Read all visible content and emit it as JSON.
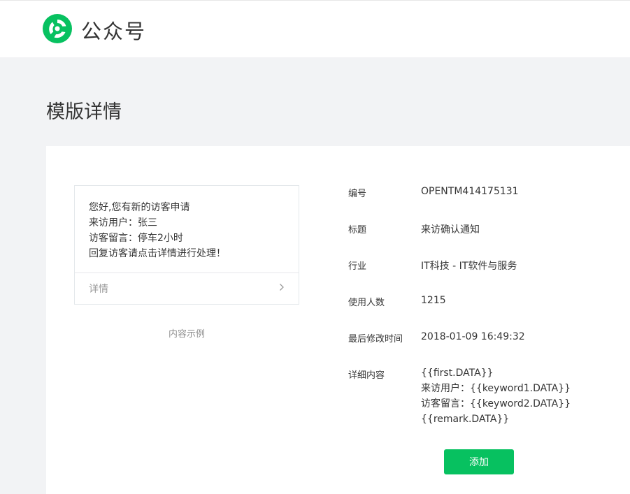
{
  "header": {
    "brand": "公众号",
    "brand_color": "#07c160",
    "logo_icon": "wechat-official-account-logo-icon"
  },
  "page": {
    "title": "模版详情"
  },
  "preview": {
    "lines": [
      "您好,您有新的访客申请",
      "来访用户：张三",
      "访客留言：停车2小时",
      "回复访客请点击详情进行处理！"
    ],
    "footer_label": "详情",
    "footer_icon": "chevron-right-icon",
    "caption": "内容示例"
  },
  "info": {
    "id_label": "编号",
    "id_value": "OPENTM414175131",
    "title_label": "标题",
    "title_value": "来访确认通知",
    "industry_label": "行业",
    "industry_value": "IT科技 - IT软件与服务",
    "users_label": "使用人数",
    "users_value": "1215",
    "modified_label": "最后修改时间",
    "modified_value": "2018-01-09 16:49:32",
    "content_label": "详细内容",
    "content_lines": [
      "{{first.DATA}}",
      "来访用户：{{keyword1.DATA}}",
      "访客留言：{{keyword2.DATA}}",
      "{{remark.DATA}}"
    ]
  },
  "actions": {
    "add_label": "添加",
    "add_color": "#07c160"
  }
}
